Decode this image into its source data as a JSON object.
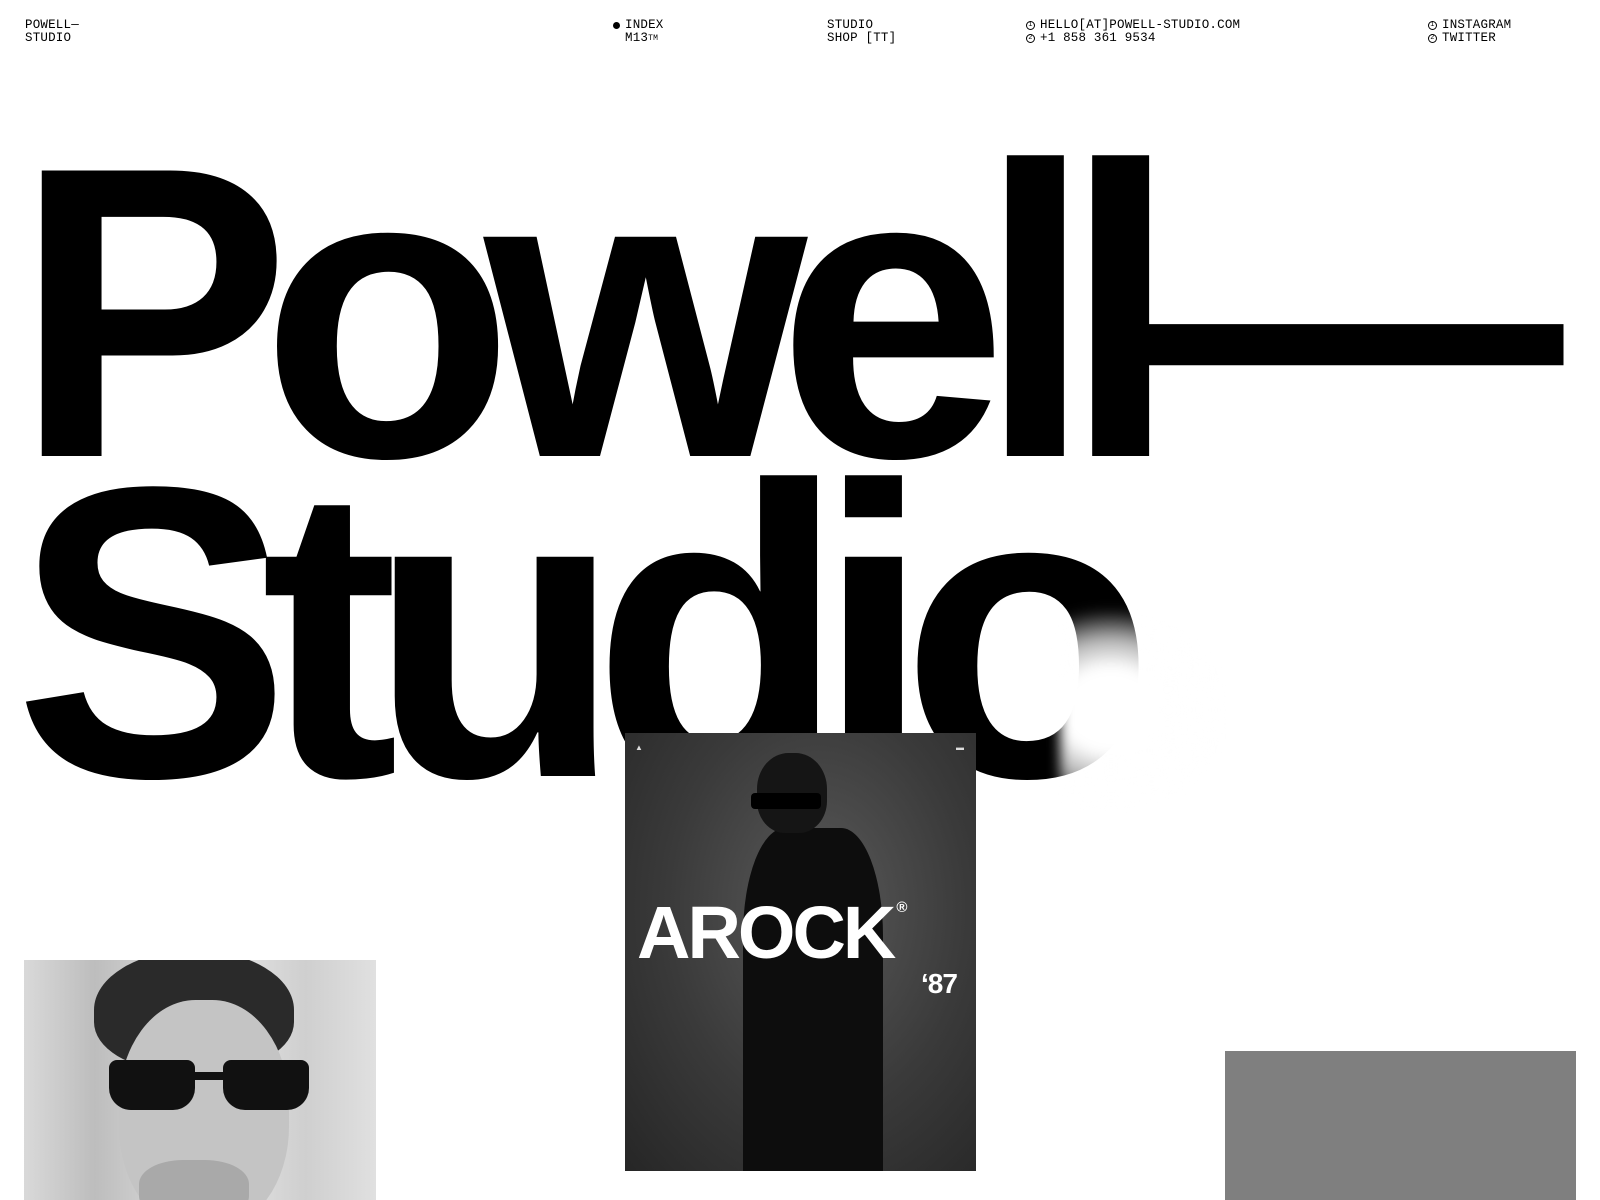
{
  "nav": {
    "logo": {
      "line1": "POWELL—",
      "line2": "STUDIO"
    },
    "index": {
      "line1": "INDEX",
      "line2": "M13",
      "sup": "TM"
    },
    "studio": {
      "line1": "STUDIO",
      "line2": "SHOP [TT]"
    },
    "contact": {
      "email_num": "1",
      "email": "HELLO[AT]POWELL-STUDIO.COM",
      "phone_num": "2",
      "phone": "+1 858 361 9534"
    },
    "social": {
      "instagram_num": "1",
      "instagram": "INSTAGRAM",
      "twitter_num": "2",
      "twitter": "TWITTER"
    }
  },
  "hero": {
    "line1": "Powell—",
    "line2": "Studio"
  },
  "projects": {
    "arock": {
      "title": "AROCK",
      "reg": "®",
      "year": "‘87"
    }
  },
  "colors": {
    "background": "#ffffff",
    "text": "#000000",
    "grey_block": "#7f7f7f",
    "card_dark": "#3a3a3a"
  }
}
